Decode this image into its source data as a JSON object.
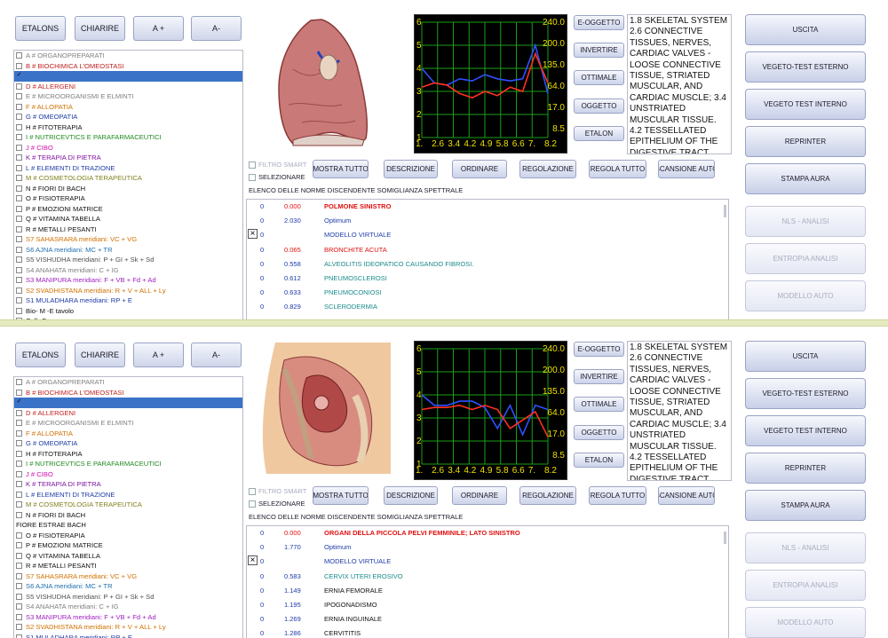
{
  "toolbar": [
    "ETALONS",
    "CHIARIRE",
    "A +",
    "A-"
  ],
  "right_buttons": [
    {
      "label": "USCITA",
      "enabled": true
    },
    {
      "label": "VEGETO-TEST ESTERNO",
      "enabled": true
    },
    {
      "label": "VEGETO TEST INTERNO",
      "enabled": true
    },
    {
      "label": "REPRINTER",
      "enabled": true
    },
    {
      "label": "STAMPA AURA",
      "enabled": true
    },
    {
      "label": "NLS - ANALISI",
      "enabled": false
    },
    {
      "label": "ENTROPIA ANALISI",
      "enabled": false
    },
    {
      "label": "MODELLO AUTO",
      "enabled": false
    }
  ],
  "chart_buttons": [
    "E-OGGETTO",
    "INVERTIRE",
    "OTTIMALE",
    "OGGETTO",
    "ETALON"
  ],
  "middle_buttons": [
    "MOSTRA TUTTO",
    "DESCRIZIONE",
    "ORDINARE",
    "REGOLAZIONE",
    "REGOLA TUTTO",
    "SCANSIONE AUTO"
  ],
  "filter_label": "FILTRO SMART",
  "select_label": "SELEZIONARE",
  "elenco_label": "ELENCO DELLE NORME DISCENDENTE SOMIGLIANZA SPETTRALE",
  "description": "1.8 SKELETAL SYSTEM 2.6 CONNECTIVE TISSUES, NERVES, CARDIAC VALVES - LOOSE CONNECTIVE TISSUE, STRIATED MUSCULAR, AND CARDIAC MUSCLE; 3.4 UNSTRIATED MUSCULAR TISSUE. 4.2 TESSELLATED EPITHELIUM OF THE DIGESTIVE TRACT",
  "chart_data": {
    "type": "line",
    "x_ticks": [
      "1.",
      "2.6",
      "3.4",
      "4.2",
      "4.9",
      "5.8",
      "6.6",
      "7.",
      "8.2"
    ],
    "y_left_ticks": [
      "6",
      "5",
      "4",
      "3",
      "2",
      "1"
    ],
    "y_right_ticks": [
      "240.0",
      "200.0",
      "135.0",
      "64.0",
      "17.0",
      "8.5"
    ],
    "ylim": [
      0,
      6
    ],
    "grid": true,
    "panels": [
      {
        "series": [
          {
            "color": "#3050ff",
            "values": [
              3.8,
              3.1,
              3.0,
              3.3,
              3.2,
              3.5,
              3.3,
              3.2,
              3.3,
              4.9,
              2.6
            ]
          },
          {
            "color": "#ff3020",
            "values": [
              2.9,
              3.1,
              3.0,
              2.6,
              2.4,
              2.7,
              2.5,
              2.9,
              2.7,
              4.5,
              3.1
            ]
          }
        ]
      },
      {
        "series": [
          {
            "color": "#3050ff",
            "values": [
              3.8,
              3.3,
              3.3,
              3.5,
              3.5,
              3.2,
              2.2,
              3.3,
              1.9,
              3.3,
              3.1
            ]
          },
          {
            "color": "#ff3020",
            "values": [
              3.1,
              3.2,
              3.2,
              3.3,
              3.1,
              3.3,
              3.1,
              2.2,
              2.6,
              3.0,
              1.8
            ]
          }
        ]
      }
    ]
  },
  "panels": [
    {
      "list": [
        {
          "text": "A # ORGANOPREPARATI",
          "color": "#808080",
          "checked": false
        },
        {
          "text": "B # BIOCHIMICA L'OMEOSTASI",
          "color": "#c02020",
          "checked": false
        },
        {
          "text": "",
          "color": "#ffffff",
          "checked": true,
          "selected": true
        },
        {
          "text": "D # ALLERGENI",
          "color": "#c02020",
          "checked": false
        },
        {
          "text": "E # MICROORGANISMI E ELMINTI",
          "color": "#808080",
          "checked": false
        },
        {
          "text": "F # ALLOPATIA",
          "color": "#d07000",
          "checked": false
        },
        {
          "text": "G # OMEOPATIA",
          "color": "#1d3aa8",
          "checked": false
        },
        {
          "text": "H # FITOTERAPIA",
          "color": "#111111",
          "checked": false
        },
        {
          "text": "I # NUTRICEVTICS E PARAFARMACEUTICI",
          "color": "#1f8a1f",
          "checked": false
        },
        {
          "text": "J # CIBO",
          "color": "#d010b0",
          "checked": false
        },
        {
          "text": "K # TERAPIA DI PIETRA",
          "color": "#8010a0",
          "checked": false
        },
        {
          "text": "L # ELEMENTI DI TRAZIONE",
          "color": "#1d3aa8",
          "checked": false
        },
        {
          "text": "M # COSMETOLOGIA TERAPEUTICA",
          "color": "#808020",
          "checked": false
        },
        {
          "text": "N # FIORI DI BACH",
          "color": "#111111",
          "checked": false
        },
        {
          "text": "O # FISIOTERAPIA",
          "color": "#111111",
          "checked": false
        },
        {
          "text": "P # EMOZIONI MATRICE",
          "color": "#111111",
          "checked": false
        },
        {
          "text": "Q # VITAMINA TABELLA",
          "color": "#111111",
          "checked": false
        },
        {
          "text": "R # METALLI PESANTI",
          "color": "#111111",
          "checked": false
        },
        {
          "text": "S7 SAHASRARA meridiani: VC + VG",
          "color": "#d07000",
          "checked": false
        },
        {
          "text": "S6 AJNA meridiani: MC + TR",
          "color": "#2070b0",
          "checked": false
        },
        {
          "text": "S5 VISHUDHA meridiani: P + GI + Sk + Sd",
          "color": "#505050",
          "checked": false
        },
        {
          "text": "S4 ANAHATA meridiani: C + IG",
          "color": "#808080",
          "checked": false
        },
        {
          "text": "S3 MANIPURA meridiani: F + VB + Fd + Ad",
          "color": "#a020c0",
          "checked": false
        },
        {
          "text": "S2 SVADHISTANA meridiani: R + V + ALL + Ly",
          "color": "#d07000",
          "checked": false
        },
        {
          "text": "S1 MULADHARA meridiani: RP + E",
          "color": "#1d3aa8",
          "checked": false
        },
        {
          "text": "Bio- M -E tavolo",
          "color": "#111111",
          "checked": false
        },
        {
          "text": "Cell- Com",
          "color": "#111111",
          "checked": false
        }
      ],
      "results": [
        {
          "a": "0",
          "b": "0.000",
          "name": "POLMONE SINISTRO",
          "color": "#e01010",
          "bold": true
        },
        {
          "a": "0",
          "b": "2.030",
          "name": "Optimum",
          "color": "#1d3aa8"
        },
        {
          "a": "0",
          "b": "",
          "name": "MODELLO VIRTUALE",
          "color": "#1d3aa8",
          "x": true
        },
        {
          "a": "0",
          "b": "0.065",
          "name": "BRONCHITE ACUTA",
          "color": "#e01010"
        },
        {
          "a": "0",
          "b": "0.558",
          "name": "ALVEOLITIS IDEOPATICO CAUSANDO FIBROSI.",
          "color": "#1a8a8a"
        },
        {
          "a": "0",
          "b": "0.612",
          "name": "PNEUMOSCLEROSI",
          "color": "#1a8a8a"
        },
        {
          "a": "0",
          "b": "0.633",
          "name": "PNEUMOCONIOSI",
          "color": "#1a8a8a"
        },
        {
          "a": "0",
          "b": "0.829",
          "name": "SCLERODERMIA",
          "color": "#1a8a8a"
        },
        {
          "a": "0",
          "b": "0.880",
          "name": "ALLERGIA",
          "color": "#1a8a8a"
        }
      ]
    },
    {
      "list": [
        {
          "text": "A # ORGANOPREPARATI",
          "color": "#808080",
          "checked": false
        },
        {
          "text": "B # BIOCHIMICA L'OMEOSTASI",
          "color": "#c02020",
          "checked": false
        },
        {
          "text": "",
          "color": "#ffffff",
          "checked": true,
          "selected": true
        },
        {
          "text": "D # ALLERGENI",
          "color": "#c02020",
          "checked": false
        },
        {
          "text": "E # MICROORGANISMI E ELMINTI",
          "color": "#808080",
          "checked": false
        },
        {
          "text": "F # ALLOPATIA",
          "color": "#d07000",
          "checked": false
        },
        {
          "text": "G # OMEOPATIA",
          "color": "#1d3aa8",
          "checked": false
        },
        {
          "text": "H # FITOTERAPIA",
          "color": "#111111",
          "checked": false
        },
        {
          "text": "I # NUTRICEVTICS E PARAFARMACEUTICI",
          "color": "#1f8a1f",
          "checked": false
        },
        {
          "text": "J # CIBO",
          "color": "#d010b0",
          "checked": false
        },
        {
          "text": "K # TERAPIA DI PIETRA",
          "color": "#8010a0",
          "checked": false
        },
        {
          "text": "L # ELEMENTI DI TRAZIONE",
          "color": "#1d3aa8",
          "checked": false
        },
        {
          "text": "M # COSMETOLOGIA TERAPEUTICA",
          "color": "#808020",
          "checked": false
        },
        {
          "text": "N # FIORI DI BACH",
          "color": "#111111",
          "checked": false
        },
        {
          "text": "FIORE ESTRAE BACH",
          "color": "#111111",
          "checked": false,
          "nocb": true
        },
        {
          "text": "O # FISIOTERAPIA",
          "color": "#111111",
          "checked": false
        },
        {
          "text": "P # EMOZIONI MATRICE",
          "color": "#111111",
          "checked": false
        },
        {
          "text": "Q # VITAMINA TABELLA",
          "color": "#111111",
          "checked": false
        },
        {
          "text": "R # METALLI PESANTI",
          "color": "#111111",
          "checked": false
        },
        {
          "text": "S7 SAHASRARA meridiani: VC + VG",
          "color": "#d07000",
          "checked": false
        },
        {
          "text": "S6 AJNA meridiani: MC + TR",
          "color": "#2070b0",
          "checked": false
        },
        {
          "text": "S5 VISHUDHA meridiani: P + GI + Sk + Sd",
          "color": "#505050",
          "checked": false
        },
        {
          "text": "S4 ANAHATA meridiani: C + IG",
          "color": "#808080",
          "checked": false
        },
        {
          "text": "S3 MANIPURA meridiani: F + VB + Fd + Ad",
          "color": "#a020c0",
          "checked": false
        },
        {
          "text": "S2 SVADHISTANA meridiani: R + V + ALL + Ly",
          "color": "#d07000",
          "checked": false
        },
        {
          "text": "S1 MULADHARA meridiani: RP + E",
          "color": "#1d3aa8",
          "checked": false
        }
      ],
      "results": [
        {
          "a": "0",
          "b": "0.000",
          "name": "ORGANI DELLA PICCOLA PELVI FEMMINILE; LATO SINISTRO",
          "color": "#e01010",
          "bold": true
        },
        {
          "a": "0",
          "b": "1.770",
          "name": "Optimum",
          "color": "#1d3aa8"
        },
        {
          "a": "0",
          "b": "",
          "name": "MODELLO VIRTUALE",
          "color": "#1d3aa8",
          "x": true
        },
        {
          "a": "0",
          "b": "0.583",
          "name": "CERVIX UTERI EROSIVO",
          "color": "#1a8a8a"
        },
        {
          "a": "0",
          "b": "1.149",
          "name": "ERNIA FEMORALE",
          "color": "#111111"
        },
        {
          "a": "0",
          "b": "1.195",
          "name": "IPOGONADISMO",
          "color": "#111111"
        },
        {
          "a": "0",
          "b": "1.269",
          "name": "ERNIA INGUINALE",
          "color": "#111111"
        },
        {
          "a": "0",
          "b": "1.286",
          "name": "CERVITITIS",
          "color": "#111111"
        }
      ]
    }
  ]
}
